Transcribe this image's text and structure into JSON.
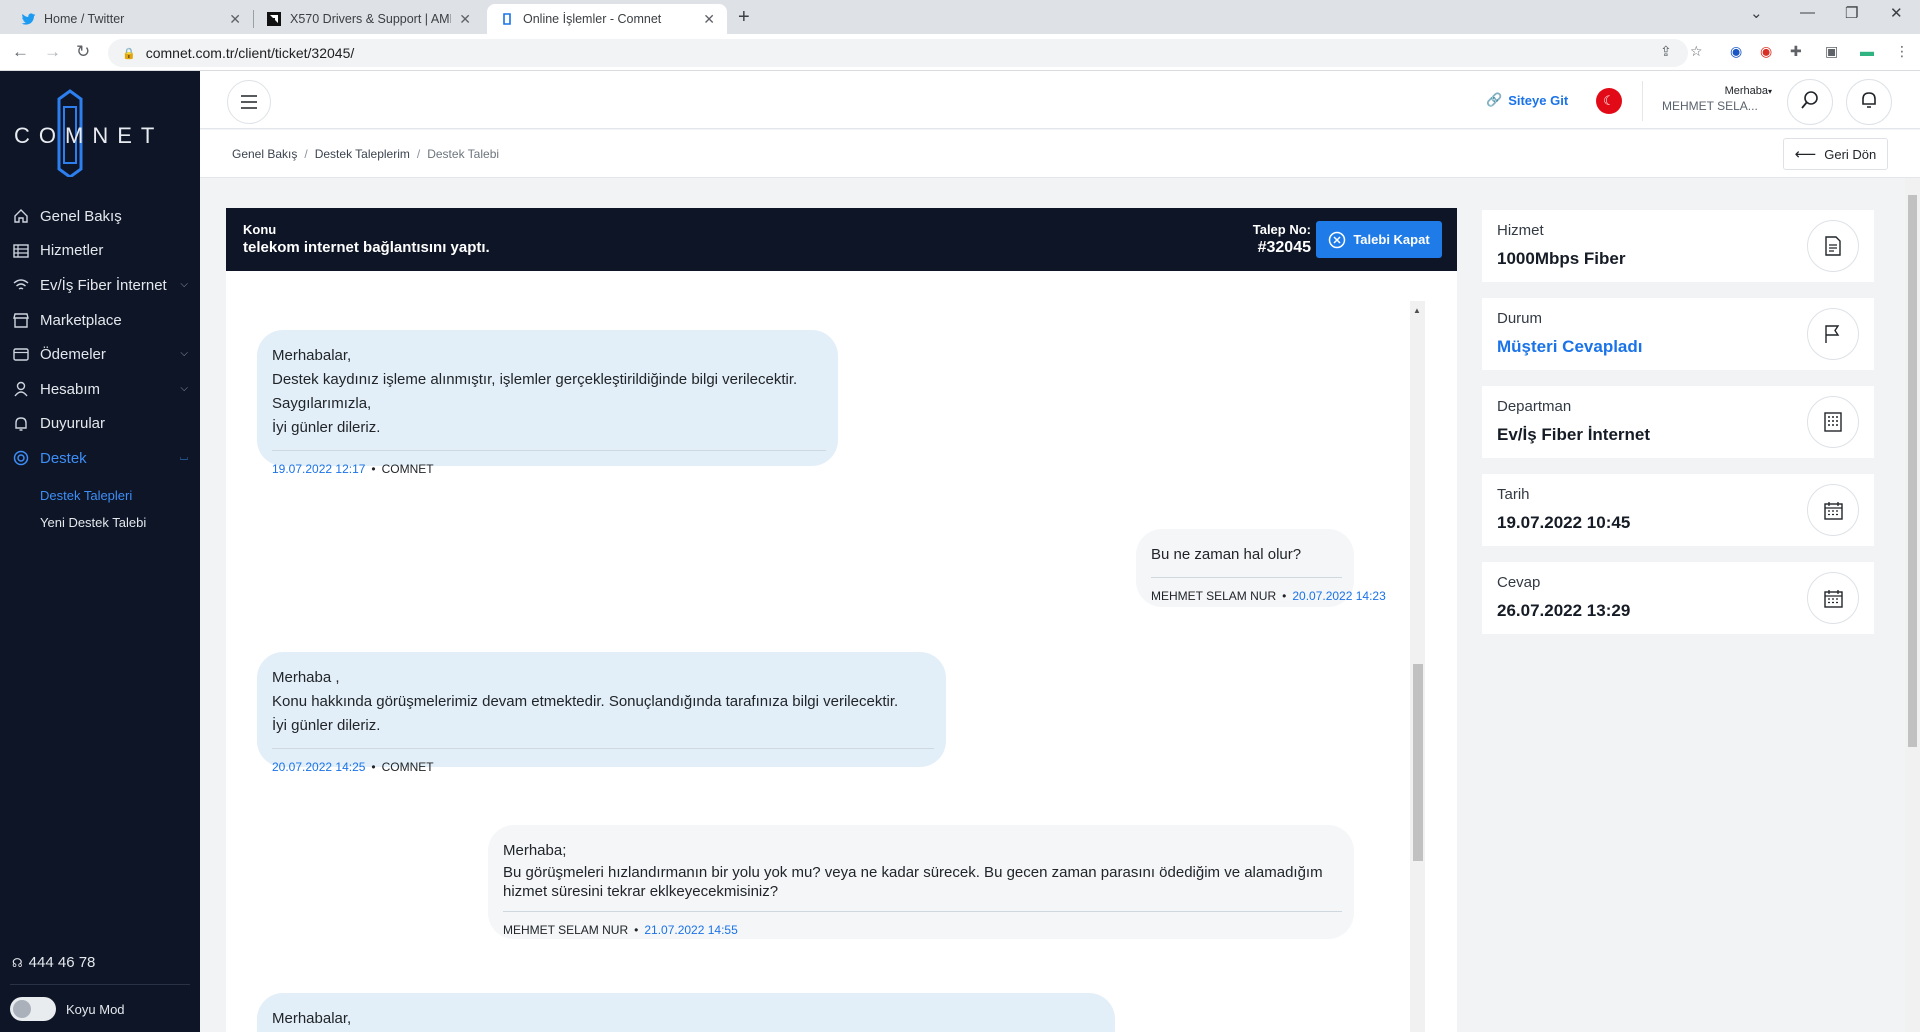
{
  "browser": {
    "tabs": [
      {
        "title": "Home / Twitter",
        "icon": "twitter-icon"
      },
      {
        "title": "X570 Drivers & Support | AMD",
        "icon": "amd-icon"
      },
      {
        "title": "Online İşlemler - Comnet",
        "icon": "comnet-icon"
      }
    ],
    "url": "comnet.com.tr/client/ticket/32045/"
  },
  "sidebar": {
    "logo_text": "COMNET",
    "items": [
      {
        "label": "Genel Bakış",
        "icon": "home-icon"
      },
      {
        "label": "Hizmetler",
        "icon": "list-icon"
      },
      {
        "label": "Ev/İş Fiber İnternet",
        "icon": "wifi-icon"
      },
      {
        "label": "Marketplace",
        "icon": "store-icon"
      },
      {
        "label": "Ödemeler",
        "icon": "wallet-icon"
      },
      {
        "label": "Hesabım",
        "icon": "user-icon"
      },
      {
        "label": "Duyurular",
        "icon": "bell-icon"
      },
      {
        "label": "Destek",
        "icon": "support-icon"
      }
    ],
    "sub_items": [
      "Destek Talepleri",
      "Yeni Destek Talebi"
    ],
    "phone": "444 46 78",
    "dark_mode_label": "Koyu Mod"
  },
  "header": {
    "site_link": "Siteye Git",
    "greeting": "Merhaba",
    "user_name": "MEHMET SELA..."
  },
  "breadcrumb": [
    "Genel Bakış",
    "Destek Taleplerim",
    "Destek Talebi"
  ],
  "back_button": "Geri Dön",
  "ticket": {
    "subject_label": "Konu",
    "subject": "telekom internet bağlantısını yaptı.",
    "number_label": "Talep No:",
    "number": "#32045",
    "close_button": "Talebi Kapat"
  },
  "messages": [
    {
      "side": "them",
      "lines": [
        "Merhabalar,",
        "Destek kaydınız işleme alınmıştır, işlemler gerçekleştirildiğinde bilgi verilecektir.",
        "Saygılarımızla,",
        "İyi günler dileriz."
      ],
      "date": "19.07.2022 12:17",
      "author": "COMNET"
    },
    {
      "side": "me",
      "lines": [
        "Bu ne zaman hal olur?"
      ],
      "date": "20.07.2022 14:23",
      "author": "MEHMET SELAM NUR"
    },
    {
      "side": "them",
      "lines": [
        "Merhaba ,",
        "Konu hakkında görüşmelerimiz devam etmektedir. Sonuçlandığında tarafınıza bilgi verilecektir.",
        "İyi günler dileriz."
      ],
      "date": "20.07.2022 14:25",
      "author": "COMNET"
    },
    {
      "side": "me",
      "lines": [
        "Merhaba;",
        "Bu görüşmeleri hızlandırmanın bir yolu yok mu?   veya ne kadar sürecek.   Bu gecen zaman parasını ödediğim ve alamadığım",
        "hizmet süresini tekrar eklkeyecekmisiniz?"
      ],
      "date": "21.07.2022 14:55",
      "author": "MEHMET SELAM NUR"
    },
    {
      "side": "them",
      "lines": [
        "Merhabalar,"
      ],
      "date": "",
      "author": ""
    }
  ],
  "info_cards": [
    {
      "label": "Hizmet",
      "value": "1000Mbps Fiber",
      "icon": "document-icon"
    },
    {
      "label": "Durum",
      "value": "Müşteri Cevapladı",
      "icon": "flag-icon"
    },
    {
      "label": "Departman",
      "value": "Ev/İş Fiber İnternet",
      "icon": "building-icon"
    },
    {
      "label": "Tarih",
      "value": "19.07.2022 10:45",
      "icon": "calendar-icon"
    },
    {
      "label": "Cevap",
      "value": "26.07.2022 13:29",
      "icon": "calendar-icon"
    }
  ],
  "colors": {
    "sidebar_bg": "#0d1526",
    "accent": "#1a73e8",
    "button_blue": "#1e7be7",
    "their_bubble": "#e3eff8",
    "my_bubble": "#f4f6f8"
  }
}
